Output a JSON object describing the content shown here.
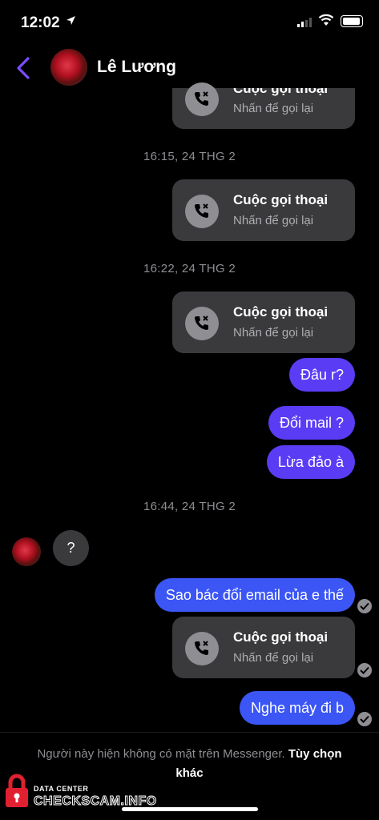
{
  "status": {
    "time": "12:02"
  },
  "header": {
    "contact_name": "Lê Lương"
  },
  "call": {
    "title": "Cuộc gọi thoại",
    "subtitle": "Nhấn để gọi lại"
  },
  "timestamps": [
    "16:15, 24 THG 2",
    "16:22, 24 THG 2",
    "16:44, 24 THG 2"
  ],
  "messages": {
    "m1": "Đâu r?",
    "m2": "Đổi mail ?",
    "m3": "Lừa đảo à",
    "received": "?",
    "m4": "Sao bác đổi email của e thế",
    "m5": "Nghe máy đi b"
  },
  "footer": {
    "text": "Người này hiện không có mặt trên Messenger.",
    "link": "Tùy chọn khác"
  },
  "watermark": {
    "line1": "DATA CENTER",
    "line2": "CHECKSCAM.INFO"
  },
  "colors": {
    "sent_bubble": "#5b3cf5",
    "sent_bubble_blue": "#3b56f5",
    "call_card": "#3a3a3c",
    "accent": "#7b4dff"
  }
}
